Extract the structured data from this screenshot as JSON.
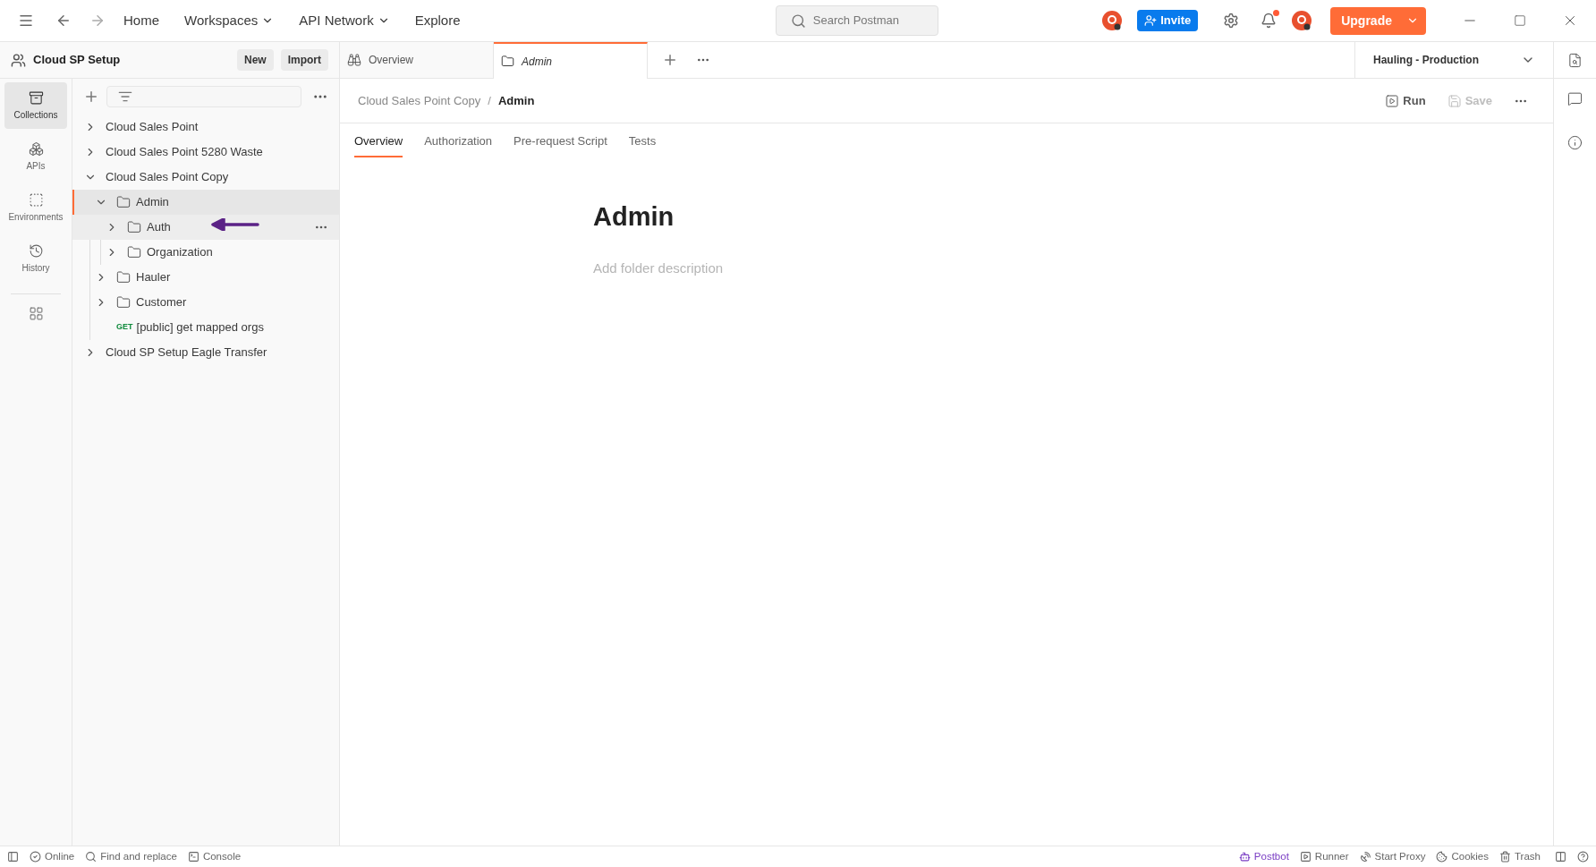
{
  "topbar": {
    "nav": [
      {
        "label": "Home",
        "has_dropdown": false
      },
      {
        "label": "Workspaces",
        "has_dropdown": true
      },
      {
        "label": "API Network",
        "has_dropdown": true
      },
      {
        "label": "Explore",
        "has_dropdown": false
      }
    ],
    "search": {
      "placeholder": "Search Postman"
    },
    "invite": "Invite",
    "notifications_unread": true,
    "upgrade": "Upgrade"
  },
  "workspace": {
    "name": "Cloud SP Setup",
    "buttons": [
      "New",
      "Import"
    ]
  },
  "rail": [
    {
      "label": "Collections",
      "kind": "collections",
      "selected": true
    },
    {
      "label": "APIs",
      "kind": "apis",
      "selected": false
    },
    {
      "label": "Environments",
      "kind": "environments",
      "selected": false
    },
    {
      "label": "History",
      "kind": "history",
      "selected": false
    }
  ],
  "tree": [
    {
      "label": "Cloud Sales Point",
      "kind": "collection",
      "expanded": false,
      "selected": false,
      "hovered": false
    },
    {
      "label": "Cloud Sales Point 5280 Waste",
      "kind": "collection",
      "expanded": false,
      "selected": false,
      "hovered": false
    },
    {
      "label": "Cloud Sales Point Copy",
      "kind": "collection",
      "expanded": true,
      "selected": false,
      "hovered": false,
      "children": [
        {
          "label": "Admin",
          "kind": "folder",
          "expanded": true,
          "selected": true,
          "hovered": false,
          "children": [
            {
              "label": "Auth",
              "kind": "folder",
              "expanded": false,
              "selected": false,
              "hovered": true
            },
            {
              "label": "Organization",
              "kind": "folder",
              "expanded": false,
              "selected": false,
              "hovered": false
            }
          ]
        },
        {
          "label": "Hauler",
          "kind": "folder",
          "expanded": false,
          "selected": false,
          "hovered": false
        },
        {
          "label": "Customer",
          "kind": "folder",
          "expanded": false,
          "selected": false,
          "hovered": false
        },
        {
          "label": "[public] get mapped orgs",
          "kind": "request",
          "method": "GET",
          "selected": false,
          "hovered": false
        }
      ]
    },
    {
      "label": "Cloud SP Setup Eagle Transfer",
      "kind": "collection",
      "expanded": false,
      "selected": false,
      "hovered": false
    }
  ],
  "tabs": [
    {
      "label": "Overview",
      "kind": "overview",
      "selected": false
    },
    {
      "label": "Admin",
      "kind": "folder",
      "selected": true
    }
  ],
  "environment": "Hauling - Production",
  "breadcrumb": {
    "items": [
      "Cloud Sales Point Copy",
      "Admin"
    ],
    "separator": "/"
  },
  "actions": [
    {
      "label": "Run",
      "kind": "run",
      "disabled": false
    },
    {
      "label": "Save",
      "kind": "save",
      "disabled": true
    }
  ],
  "subtabs": [
    {
      "label": "Overview",
      "selected": true
    },
    {
      "label": "Authorization",
      "selected": false
    },
    {
      "label": "Pre-request Script",
      "selected": false
    },
    {
      "label": "Tests",
      "selected": false
    }
  ],
  "folder": {
    "title": "Admin",
    "description_placeholder": "Add folder description"
  },
  "status_bar": {
    "left": [
      {
        "label": "Online",
        "kind": "online"
      },
      {
        "label": "Find and replace",
        "kind": "find"
      },
      {
        "label": "Console",
        "kind": "console"
      }
    ],
    "right": [
      {
        "label": "Postbot",
        "kind": "postbot"
      },
      {
        "label": "Runner",
        "kind": "runner"
      },
      {
        "label": "Start Proxy",
        "kind": "proxy"
      },
      {
        "label": "Cookies",
        "kind": "cookies"
      },
      {
        "label": "Trash",
        "kind": "trash"
      }
    ]
  }
}
